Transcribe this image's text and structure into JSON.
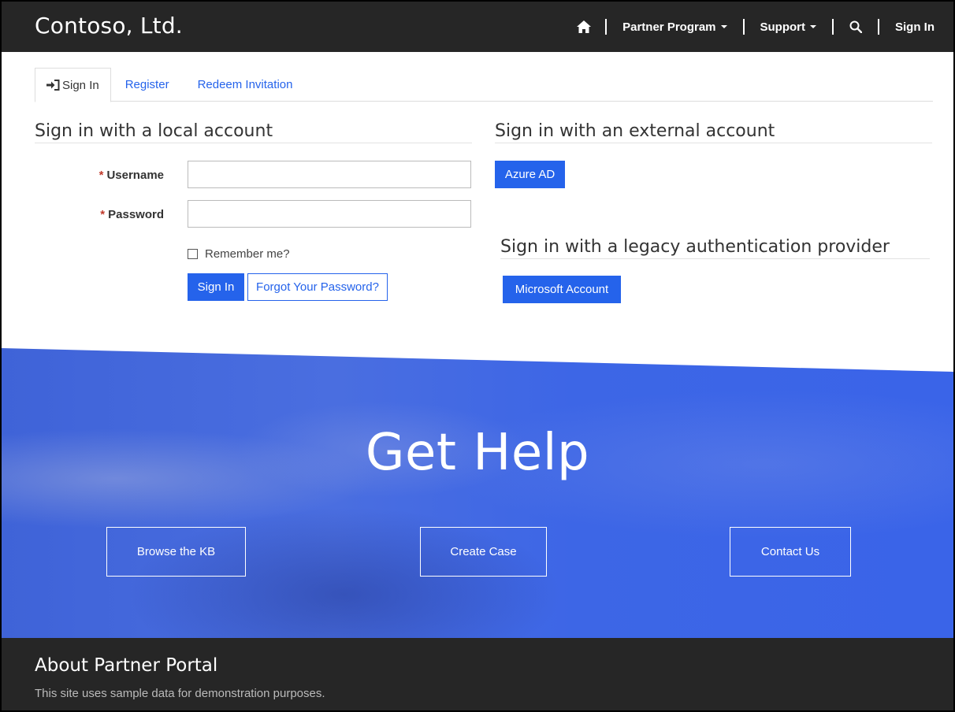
{
  "header": {
    "brand": "Contoso, Ltd.",
    "nav": {
      "partner_program": "Partner Program",
      "support": "Support",
      "sign_in": "Sign In"
    }
  },
  "tabs": {
    "sign_in": "Sign In",
    "register": "Register",
    "redeem": "Redeem Invitation"
  },
  "local": {
    "title": "Sign in with a local account",
    "username_label": "Username",
    "password_label": "Password",
    "required_mark": "*",
    "username_value": "",
    "password_value": "",
    "remember_label": "Remember me?",
    "remember_checked": false,
    "sign_in_button": "Sign In",
    "forgot_button": "Forgot Your Password?"
  },
  "external": {
    "title": "Sign in with an external account",
    "azure_button": "Azure AD"
  },
  "legacy": {
    "title": "Sign in with a legacy authentication provider",
    "microsoft_button": "Microsoft Account"
  },
  "hero": {
    "title": "Get Help",
    "browse_kb": "Browse the KB",
    "create_case": "Create Case",
    "contact_us": "Contact Us"
  },
  "footer": {
    "title": "About Partner Portal",
    "text": "This site uses sample data for demonstration purposes."
  },
  "colors": {
    "accent": "#2563eb",
    "header_bg": "#262626",
    "hero_blue": "#3d66e6"
  }
}
